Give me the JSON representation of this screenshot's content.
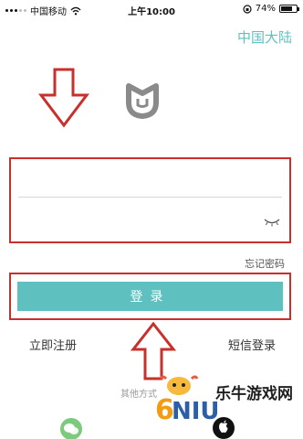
{
  "status_bar": {
    "carrier": "中国移动",
    "time": "上午10:00",
    "battery": "74%",
    "battery_level": 0.74
  },
  "header": {
    "region": "中国大陆"
  },
  "form": {
    "username_placeholder": "",
    "password_placeholder": "",
    "forgot_password": "忘记密码",
    "login_button": "登录"
  },
  "links": {
    "register": "立即注册",
    "sms_login": "短信登录"
  },
  "other_login": {
    "label": "其他方式"
  },
  "watermark": {
    "brand_text": "乐牛游戏网",
    "logo_letters": "6NIU.com"
  },
  "colors": {
    "accent": "#5ec1c0",
    "highlight": "#c9302c"
  }
}
